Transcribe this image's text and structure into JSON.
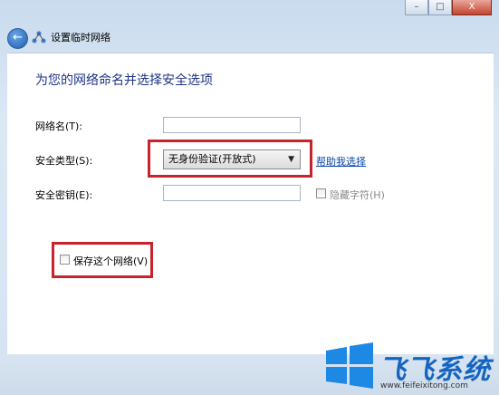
{
  "window": {
    "title": "设置临时网络",
    "buttons": {
      "minimize": "–",
      "maximize": "□",
      "close": "X"
    }
  },
  "form": {
    "heading": "为您的网络命名并选择安全选项",
    "network_name_label": "网络名(T):",
    "network_name_value": "",
    "security_type_label": "安全类型(S):",
    "security_type_value": "无身份验证(开放式)",
    "help_link": "帮助我选择",
    "security_key_label": "安全密钥(E):",
    "security_key_value": "",
    "hide_chars_label": "隐藏字符(H)",
    "hide_chars_checked": false,
    "save_network_label": "保存这个网络(V)",
    "save_network_checked": false
  },
  "watermark": {
    "brand": "飞飞系统",
    "url": "www.feifeixitong.com"
  },
  "colors": {
    "highlight": "#c8232b",
    "heading": "#1e3287",
    "link": "#0a44a8",
    "watermark": "#1565c0"
  }
}
